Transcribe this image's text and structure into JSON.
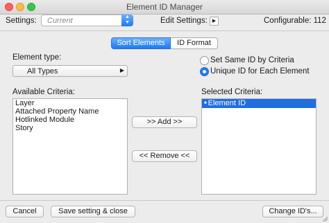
{
  "window": {
    "title": "Element ID Manager"
  },
  "header": {
    "settings_label": "Settings:",
    "settings_value": "Current",
    "edit_settings_label": "Edit Settings:",
    "configurable_label": "Configurable: 112"
  },
  "tabs": [
    {
      "label": "Sort Elements",
      "active": true
    },
    {
      "label": "ID Format",
      "active": false
    }
  ],
  "element_type": {
    "label": "Element type:",
    "value": "All Types"
  },
  "radios": [
    {
      "label": "Set Same ID by Criteria",
      "selected": false
    },
    {
      "label": "Unique ID for Each Element",
      "selected": true
    }
  ],
  "available": {
    "label": "Available Criteria:",
    "items": [
      "Layer",
      "Attached Property Name",
      "Hotlinked Module",
      "Story"
    ]
  },
  "selected": {
    "label": "Selected Criteria:",
    "items": [
      "Element ID"
    ]
  },
  "actions": {
    "add": ">> Add >>",
    "remove": "<< Remove <<"
  },
  "footer": {
    "cancel": "Cancel",
    "save_close": "Save setting & close",
    "change_ids": "Change ID's..."
  },
  "colors": {
    "accent": "#1f6ee0",
    "close": "#fc605c",
    "minimize": "#fdbc40",
    "maximize": "#34c84a"
  }
}
